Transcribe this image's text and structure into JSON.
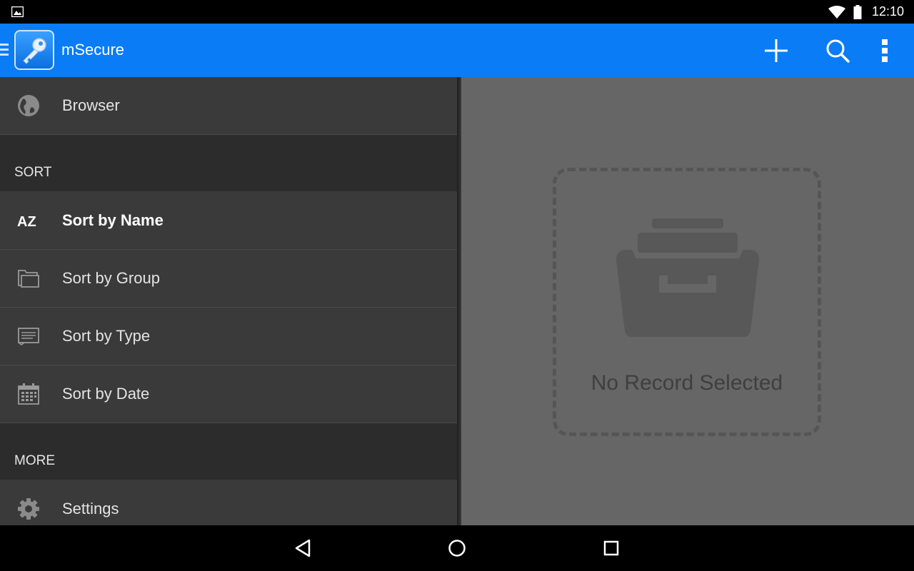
{
  "status": {
    "time": "12:10"
  },
  "app": {
    "title": "mSecure"
  },
  "toolbar": {
    "icons": {
      "add": "plus-icon",
      "search": "search-icon",
      "more": "overflow-menu-icon"
    }
  },
  "drawer": {
    "browser_label": "Browser",
    "sort_header": "SORT",
    "sort_items": [
      {
        "label": "Sort by Name",
        "icon": "az-icon",
        "active": true
      },
      {
        "label": "Sort by Group",
        "icon": "folder-icon"
      },
      {
        "label": "Sort by Type",
        "icon": "card-icon"
      },
      {
        "label": "Sort by Date",
        "icon": "calendar-icon"
      }
    ],
    "more_header": "MORE",
    "settings_label": "Settings"
  },
  "content": {
    "empty_text": "No Record Selected"
  },
  "colors": {
    "appbar": "#0a7cf6",
    "drawer": "#2f2f2f",
    "content": "#666666"
  }
}
